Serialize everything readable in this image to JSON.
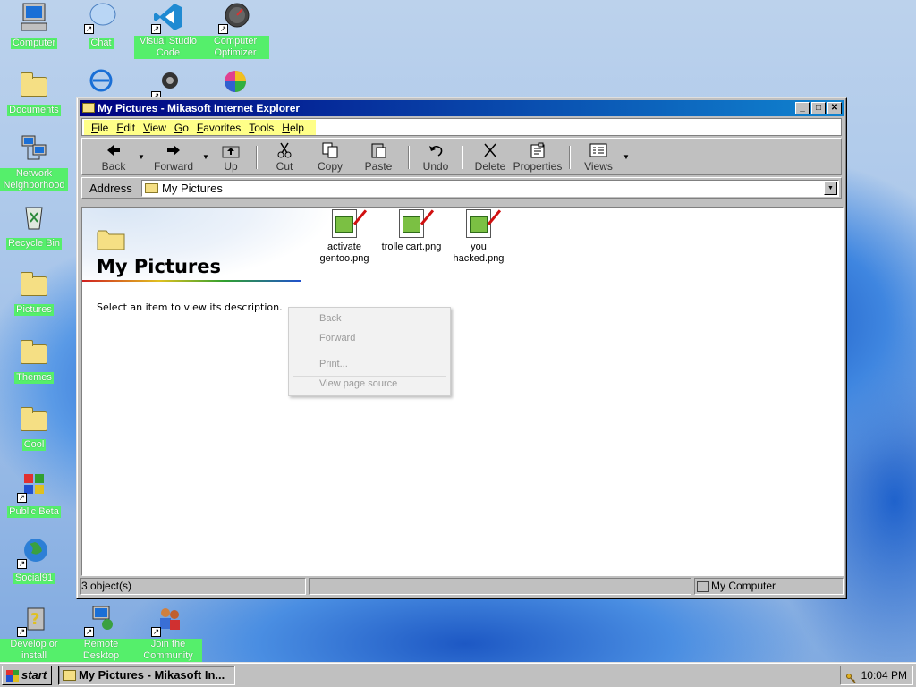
{
  "desktop": {
    "icons": [
      {
        "label": "Computer",
        "icon": "computer-icon"
      },
      {
        "label": "Chat",
        "icon": "chat-icon"
      },
      {
        "label": "Visual Studio Code",
        "icon": "vscode-icon"
      },
      {
        "label": "Computer Optimizer",
        "icon": "optimizer-icon"
      },
      {
        "label": "Documents",
        "icon": "documents-folder-icon"
      },
      {
        "label": "Network Neighborhood",
        "icon": "network-icon"
      },
      {
        "label": "Recycle Bin",
        "icon": "recycle-bin-icon"
      },
      {
        "label": "Pictures",
        "icon": "folder-icon"
      },
      {
        "label": "Themes",
        "icon": "folder-icon"
      },
      {
        "label": "Cool",
        "icon": "folder-icon"
      },
      {
        "label": "Public Beta",
        "icon": "public-beta-icon"
      },
      {
        "label": "Social91",
        "icon": "globe-icon"
      },
      {
        "label": "Develop or install",
        "icon": "develop-icon"
      },
      {
        "label": "Remote Desktop",
        "icon": "remote-desktop-icon"
      },
      {
        "label": "Join the Community",
        "icon": "community-icon"
      }
    ]
  },
  "window": {
    "title": "My Pictures - Mikasoft Internet Explorer",
    "controls": {
      "minimize": "_",
      "maximize": "□",
      "close": "✕"
    },
    "menu": [
      {
        "label": "File",
        "u": "F",
        "rest": "ile"
      },
      {
        "label": "Edit",
        "u": "E",
        "rest": "dit"
      },
      {
        "label": "View",
        "u": "V",
        "rest": "iew"
      },
      {
        "label": "Go",
        "u": "G",
        "rest": "o"
      },
      {
        "label": "Favorites",
        "u": "F",
        "rest": "avorites"
      },
      {
        "label": "Tools",
        "u": "T",
        "rest": "ools"
      },
      {
        "label": "Help",
        "u": "H",
        "rest": "elp"
      }
    ],
    "toolbar": {
      "back": "Back",
      "forward": "Forward",
      "up": "Up",
      "cut": "Cut",
      "copy": "Copy",
      "paste": "Paste",
      "undo": "Undo",
      "delete": "Delete",
      "properties": "Properties",
      "views": "Views"
    },
    "address": {
      "label": "Address",
      "value": "My Pictures"
    },
    "sidebar": {
      "title": "My Pictures",
      "description": "Select an item to view its description."
    },
    "files": [
      {
        "name": "activate gentoo.png",
        "line1": "activate",
        "line2": "gentoo.png"
      },
      {
        "name": "trolle cart.png",
        "line1": "trolle cart.png",
        "line2": ""
      },
      {
        "name": "you hacked.png",
        "line1": "you",
        "line2": "hacked.png"
      }
    ],
    "context_menu": {
      "back": "Back",
      "forward": "Forward",
      "print": "Print...",
      "view_source": "View page source"
    },
    "status": {
      "objects": "3 object(s)",
      "location": "My Computer"
    }
  },
  "taskbar": {
    "start": "start",
    "task": "My Pictures - Mikasoft In...",
    "clock": "10:04 PM"
  },
  "colors": {
    "label_bg": "#55ef6b",
    "titlebar_start": "#000080",
    "titlebar_end": "#1084d0",
    "menu_bg": "#ffff88"
  }
}
